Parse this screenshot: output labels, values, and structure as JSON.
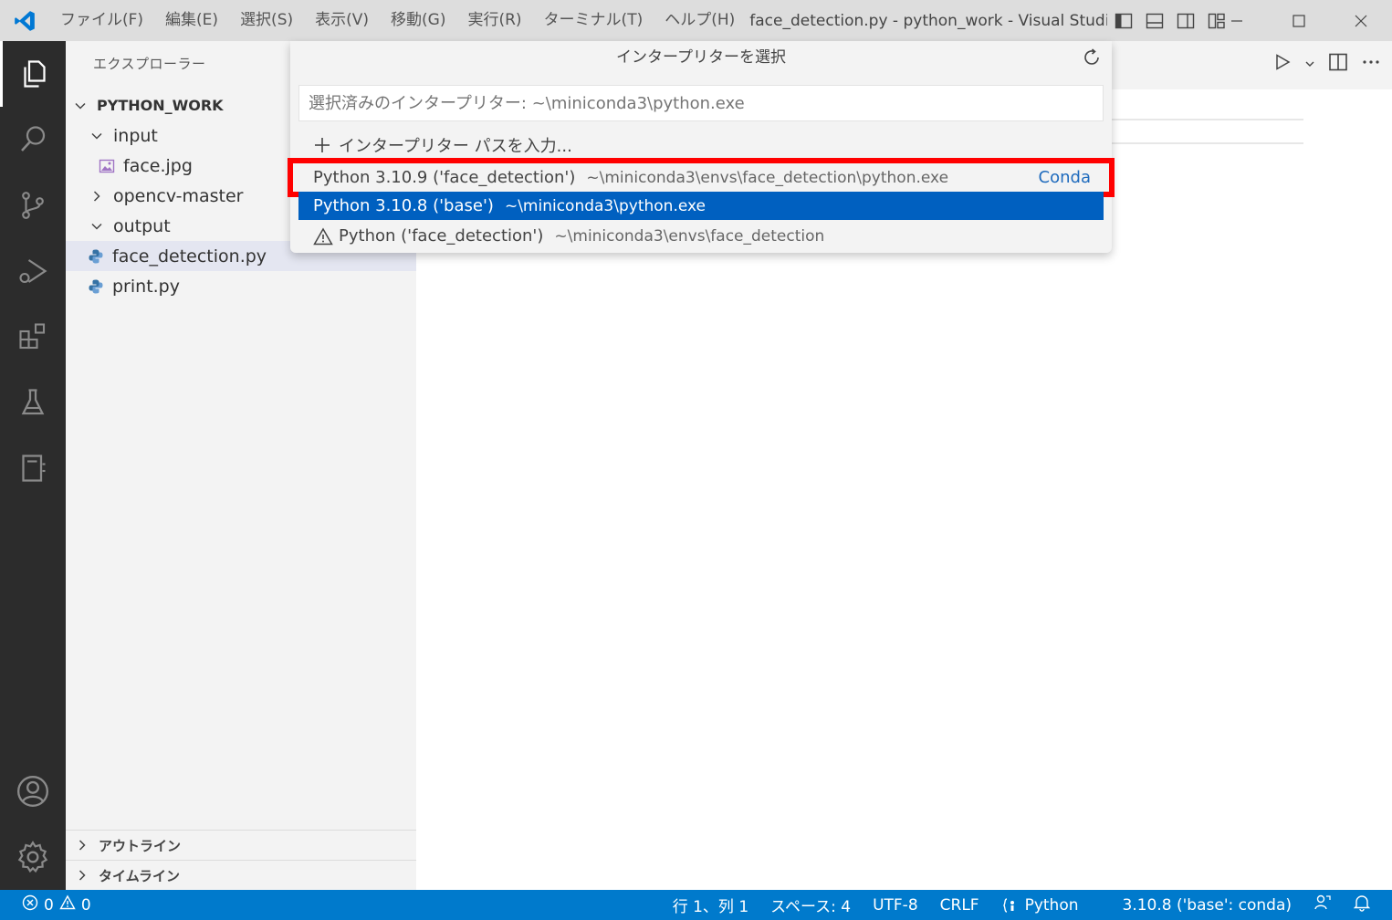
{
  "titlebar": {
    "menu": [
      "ファイル(F)",
      "編集(E)",
      "選択(S)",
      "表示(V)",
      "移動(G)",
      "実行(R)",
      "ターミナル(T)",
      "ヘルプ(H)"
    ],
    "window_title": "face_detection.py - python_work - Visual Studio..."
  },
  "sidebar": {
    "title": "エクスプローラー",
    "root": "PYTHON_WORK",
    "items": [
      {
        "label": "input"
      },
      {
        "label": "face.jpg"
      },
      {
        "label": "opencv-master"
      },
      {
        "label": "output"
      },
      {
        "label": "face_detection.py"
      },
      {
        "label": "print.py"
      }
    ],
    "outline": "アウトライン",
    "timeline": "タイムライン"
  },
  "quickpick": {
    "title": "インタープリターを選択",
    "placeholder": "選択済みのインタープリター: ~\\miniconda3\\python.exe",
    "items": [
      {
        "label": "インタープリター パスを入力...",
        "desc": ""
      },
      {
        "label": "Python 3.10.9 ('face_detection')",
        "desc": "~\\miniconda3\\envs\\face_detection\\python.exe",
        "tag": "Conda"
      },
      {
        "label": "Python 3.10.8 ('base')",
        "desc": "~\\miniconda3\\python.exe"
      },
      {
        "label": "Python ('face_detection')",
        "desc": "~\\miniconda3\\envs\\face_detection"
      }
    ]
  },
  "statusbar": {
    "errors": "0",
    "warnings": "0",
    "position": "行 1、列 1",
    "spaces": "スペース: 4",
    "encoding": "UTF-8",
    "eol": "CRLF",
    "language": "Python",
    "interpreter": "3.10.8 ('base': conda)"
  },
  "colors": {
    "activity_bar": "#2c2c2c",
    "sidebar": "#f3f3f3",
    "statusbar": "#007acc",
    "selection": "#0060c0",
    "highlight_border": "#ff0000"
  }
}
